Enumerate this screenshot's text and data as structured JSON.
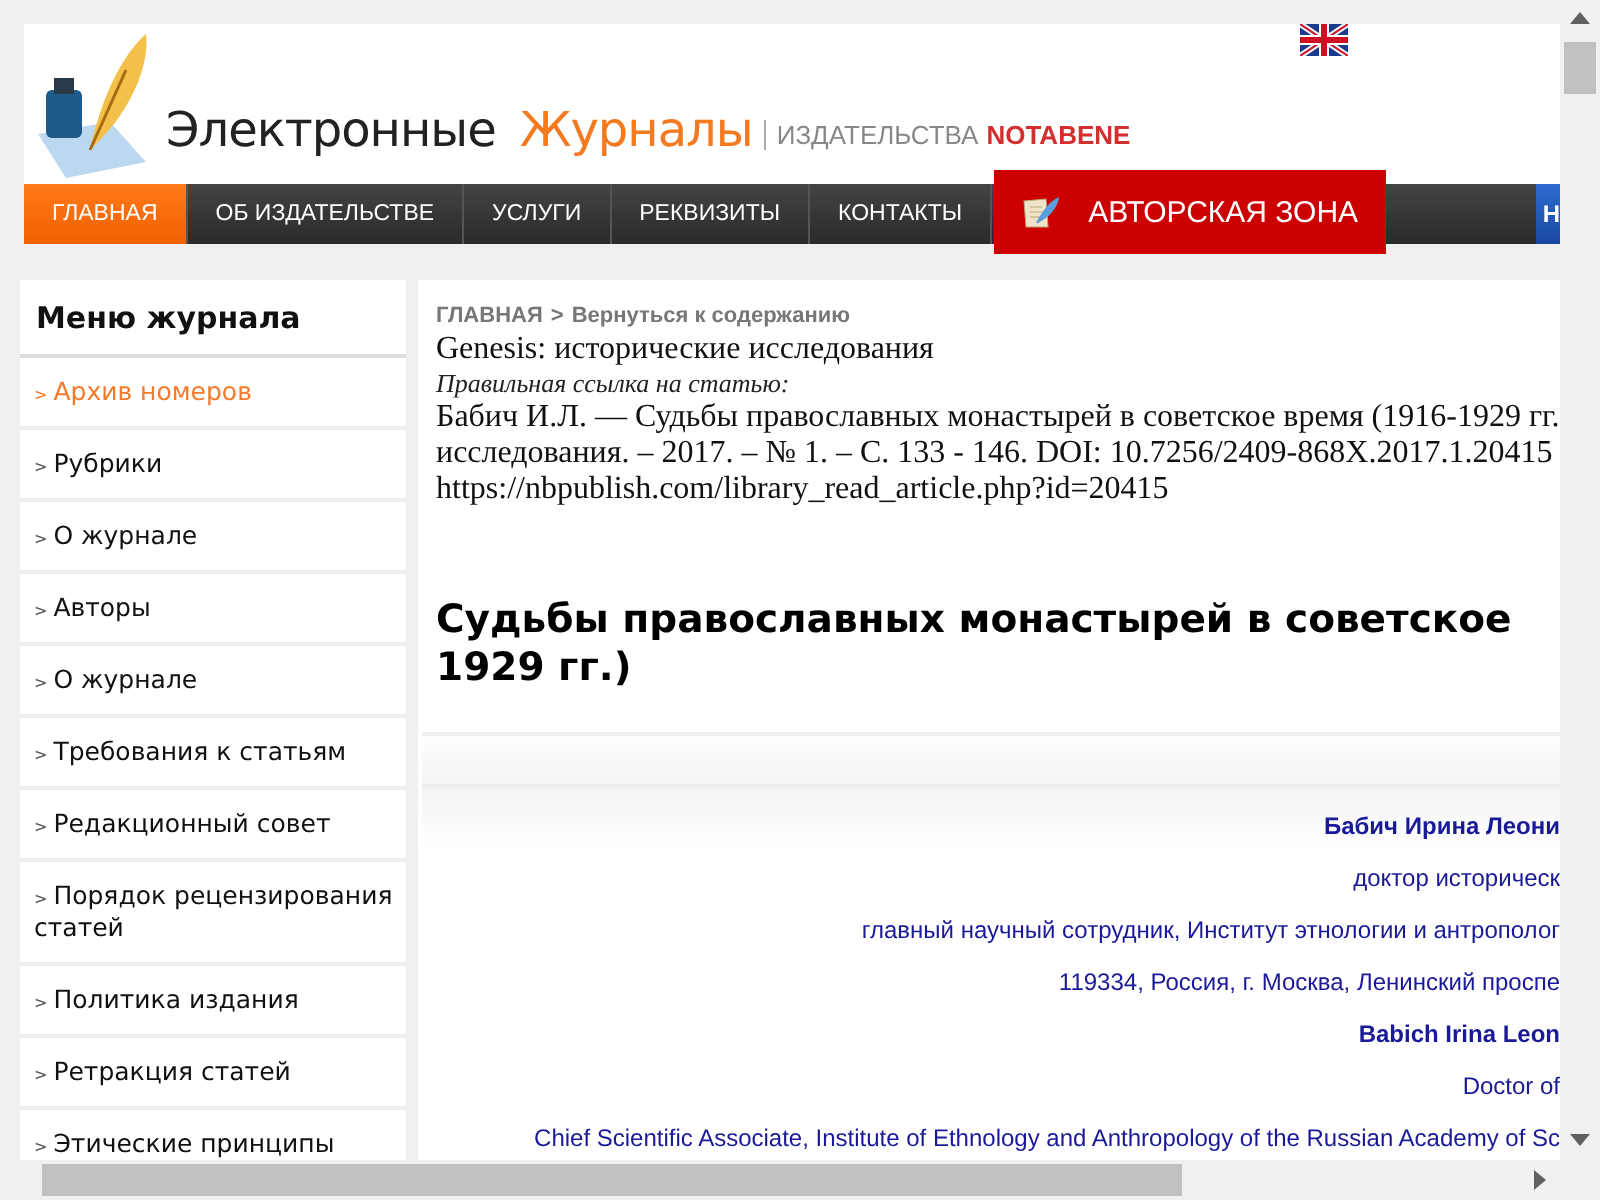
{
  "header": {
    "title": "Электронные",
    "title_accent": "Журналы",
    "publisher_label": "ИЗДАТЕЛЬСТВА",
    "publisher_name": "NOTABENE"
  },
  "nav": [
    {
      "label": "ГЛАВНАЯ",
      "selected": true
    },
    {
      "label": "ОБ ИЗДАТЕЛЬСТВЕ",
      "selected": false
    },
    {
      "label": "УСЛУГИ",
      "selected": false
    },
    {
      "label": "РЕКВИЗИТЫ",
      "selected": false
    },
    {
      "label": "КОНТАКТЫ",
      "selected": false
    }
  ],
  "author_zone": "АВТОРСКАЯ ЗОНА",
  "nav_extra": "Н",
  "sidebar": {
    "title": "Меню журнала",
    "items": [
      {
        "marker": ">",
        "label": "Архив номеров",
        "selected": true
      },
      {
        "marker": ">",
        "label": "Рубрики",
        "selected": false
      },
      {
        "marker": ">",
        "label": "О журнале",
        "selected": false
      },
      {
        "marker": ">",
        "label": "Авторы",
        "selected": false
      },
      {
        "marker": ">",
        "label": "О журнале",
        "selected": false
      },
      {
        "marker": ">",
        "label": "Требования к статьям",
        "selected": false
      },
      {
        "marker": ">",
        "label": "Редакционный совет",
        "selected": false
      },
      {
        "marker": ">",
        "label": "Порядок рецензирования статей",
        "selected": false
      },
      {
        "marker": ">",
        "label": "Политика издания",
        "selected": false
      },
      {
        "marker": ">",
        "label": "Ретракция статей",
        "selected": false
      },
      {
        "marker": ">",
        "label": "Этические принципы",
        "selected": false
      }
    ]
  },
  "breadcrumb": {
    "home": "ГЛАВНАЯ",
    "separator": ">",
    "back": "Вернуться к содержанию"
  },
  "journal": "Genesis: исторические исследования",
  "citation_label": "Правильная ссылка на статью:",
  "citation": [
    "Бабич И.Л. — Судьбы православных монастырей в советское время (1916-1929 гг.",
    "исследования. – 2017. – № 1. – С. 133 - 146. DOI: 10.7256/2409-868X.2017.1.20415",
    "https://nbpublish.com/library_read_article.php?id=20415"
  ],
  "article_title": [
    "Судьбы православных монастырей в советское",
    "1929 гг.)"
  ],
  "authors": [
    {
      "kind": "name",
      "text": "Бабич Ирина Леони"
    },
    {
      "kind": "info",
      "text": "доктор историческ"
    },
    {
      "kind": "info",
      "text": "главный научный сотрудник, Институт этнологии и антрополог"
    },
    {
      "kind": "info",
      "text": "119334, Россия, г. Москва, Ленинский проспе"
    },
    {
      "kind": "name",
      "text": "Babich Irina Leon"
    },
    {
      "kind": "info",
      "text": "Doctor of"
    },
    {
      "kind": "info",
      "text": "Chief Scientific Associate, Institute of Ethnology and Anthropology of the Russian Academy of Sc"
    }
  ]
}
